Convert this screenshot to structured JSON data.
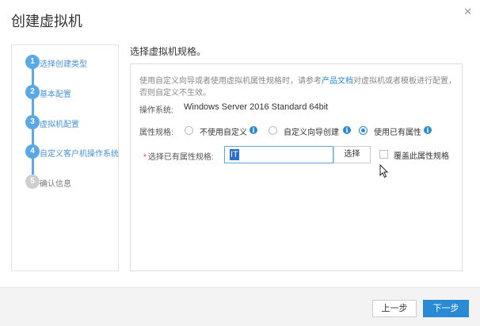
{
  "dialog": {
    "title": "创建虚拟机",
    "close_icon": "close-icon"
  },
  "steps": [
    {
      "number": "1",
      "label": "选择创建类型",
      "state": "done"
    },
    {
      "number": "2",
      "label": "基本配置",
      "state": "done"
    },
    {
      "number": "3",
      "label": "虚拟机配置",
      "state": "done"
    },
    {
      "number": "4",
      "label": "自定义客户机操作系统",
      "state": "current"
    },
    {
      "number": "5",
      "label": "确认信息",
      "state": "pending"
    }
  ],
  "content": {
    "title": "选择虚拟机规格。",
    "hint_before": "使用自定义向导或者使用虚拟机属性规格时，请参考",
    "hint_link": "产品文档",
    "hint_after": "对虚拟机或者模板进行配置，否则自定义不生效。",
    "os_label": "操作系统:",
    "os_value": "Windows Server 2016 Standard 64bit",
    "spec_label": "属性规格:",
    "radio_options": [
      {
        "label": "不使用自定义",
        "checked": false,
        "info_icon": "info-icon"
      },
      {
        "label": "自定义向导创建",
        "checked": false,
        "info_icon": "info-icon"
      },
      {
        "label": "使用已有属性",
        "checked": true,
        "info_icon": "info-icon"
      }
    ],
    "existing_spec_label": "选择已有属性规格:",
    "required_mark": "*",
    "existing_spec_value": "IT",
    "select_button": "选择",
    "override_checkbox_label": "覆盖此属性规格",
    "override_checked": false
  },
  "footer": {
    "prev_button": "上一步",
    "next_button": "下一步"
  },
  "colors": {
    "accent": "#2a8ad4",
    "step_active": "#5aa9e6",
    "step_pending": "#cfcfcf",
    "required": "#e03e3e"
  }
}
